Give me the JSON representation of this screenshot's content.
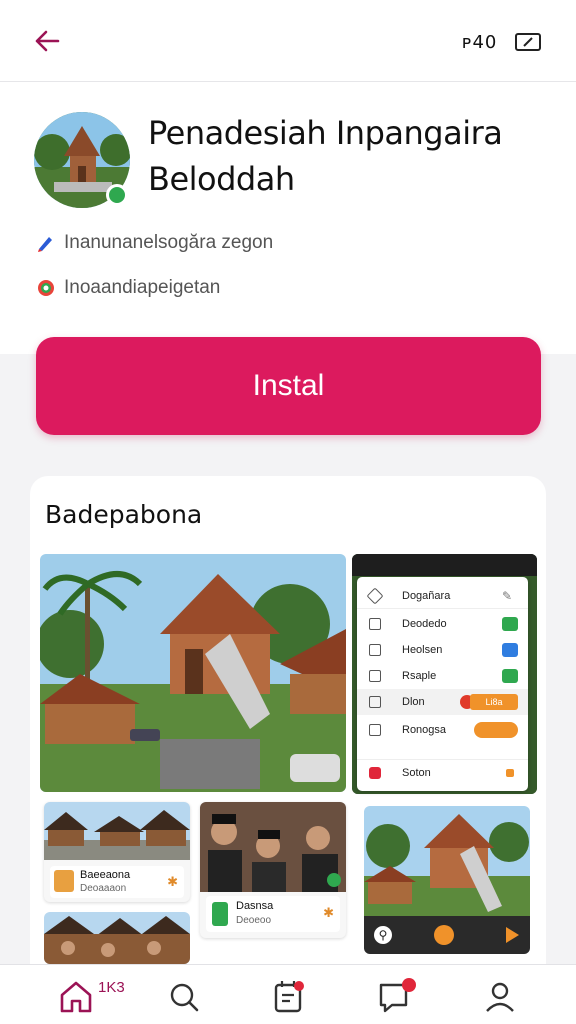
{
  "topbar": {
    "right_text": "ᴘ40",
    "back_icon": "arrow-left-icon",
    "screen_icon": "screen-icon"
  },
  "app": {
    "title_line1": "Penadesiah Inpangaira",
    "title_line2": "Beloddah",
    "meta1": "Inanunanelsogăra zegon",
    "meta2": "Inoaandiapeigetan"
  },
  "install": {
    "label": "Instal"
  },
  "section": {
    "title": "Badepabona"
  },
  "menu": {
    "header": "Dogañara",
    "items": [
      {
        "label": "Deodedo"
      },
      {
        "label": "Heolsen"
      },
      {
        "label": "Rsaple"
      },
      {
        "label": "Dlon"
      },
      {
        "label": "Ronogsa"
      }
    ],
    "footer": "Soton",
    "orange_tag": "Li8a"
  },
  "captions": {
    "card1_a": "Baeeaona",
    "card1_b": "Deoaaaon",
    "card2_a": "Dasnsa",
    "card2_b": "Deoeoo"
  },
  "nav": {
    "home_label": "1K3"
  },
  "colors": {
    "accent": "#dc1a5e",
    "nav_accent": "#9b1355"
  }
}
